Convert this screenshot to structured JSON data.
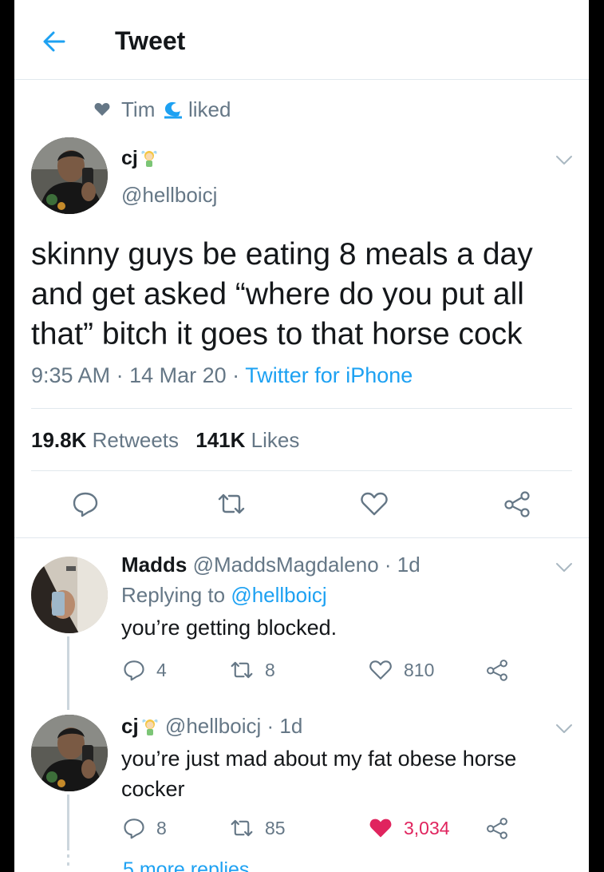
{
  "header": {
    "title": "Tweet"
  },
  "context": {
    "name": "Tim",
    "suffix": "liked"
  },
  "tweet": {
    "display_name": "cj",
    "handle": "@hellboicj",
    "text_lines": [
      "skinny guys be eating 8 meals a day",
      "and get asked “where do you put all",
      "that” bitch it goes to that horse cock"
    ],
    "time": "9:35 AM",
    "date": "14 Mar 20",
    "source": "Twitter for iPhone",
    "retweets_count": "19.8K",
    "retweets_label": "Retweets",
    "likes_count": "141K",
    "likes_label": "Likes"
  },
  "replies": [
    {
      "display_name": "Madds",
      "handle": "@MaddsMagdaleno",
      "age": "1d",
      "replying_prefix": "Replying to",
      "replying_handle": "@hellboicj",
      "text": "you’re getting blocked.",
      "reply_count": "4",
      "retweet_count": "8",
      "like_count": "810"
    },
    {
      "display_name": "cj",
      "handle": "@hellboicj",
      "age": "1d",
      "text_lines": [
        "you’re just mad about my fat obese horse",
        "cocker"
      ],
      "reply_count": "8",
      "retweet_count": "85",
      "like_count": "3,034",
      "liked": true
    }
  ],
  "more_replies": "5 more replies",
  "colors": {
    "accent": "#1da1f2",
    "like_red": "#e0245e",
    "muted": "#657786",
    "text": "#14171a"
  }
}
